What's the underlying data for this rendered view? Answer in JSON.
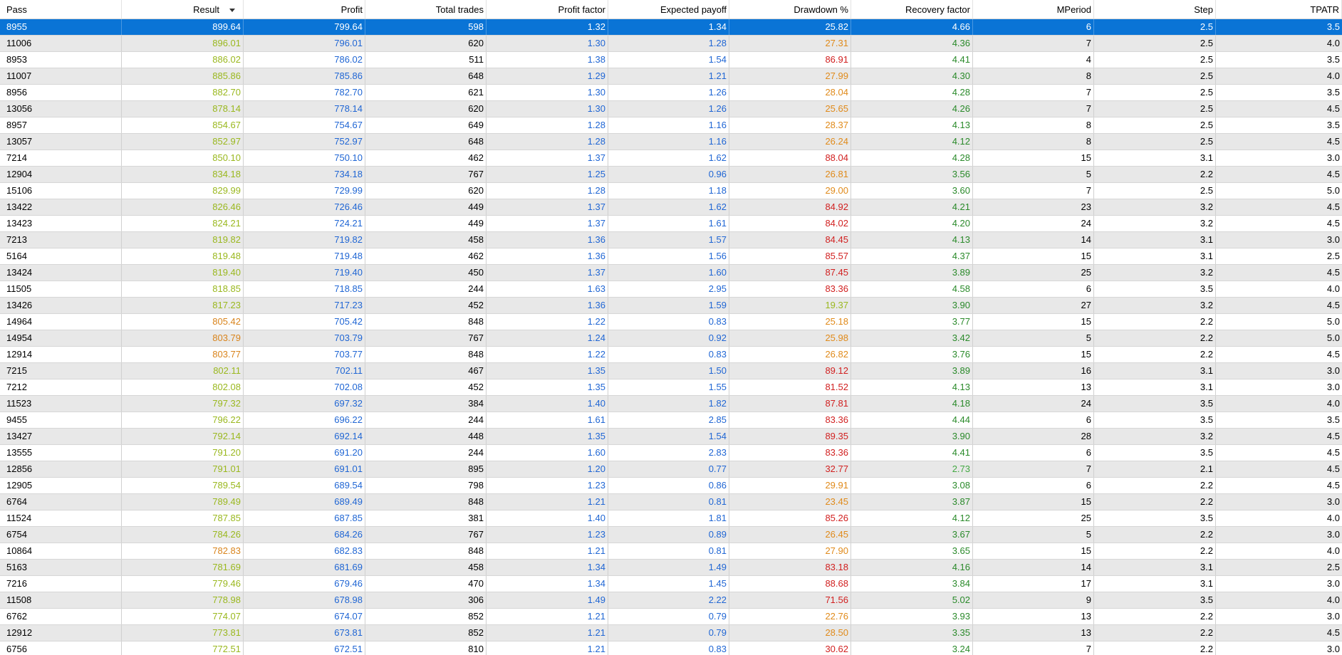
{
  "columns": [
    "Pass",
    "Result",
    "Profit",
    "Total trades",
    "Profit factor",
    "Expected payoff",
    "Drawdown %",
    "Recovery factor",
    "MPeriod",
    "Step",
    "TPATR"
  ],
  "sorted_column": "Result",
  "sort_icon": "chevron-down-icon",
  "colors": {
    "result_yellowgreen": "#9ab81e",
    "result_orange": "#d9841c",
    "blue": "#2066d4",
    "drawdown_red": "#d11f1f",
    "drawdown_orange": "#e08a1a",
    "drawdown_yellowgreen": "#9ab81e",
    "recovery_green": "#2a8a2a",
    "recovery_lightgreen": "#42a842",
    "selected_bg": "#0a74d6"
  },
  "rows": [
    {
      "pass": "8955",
      "result": "899.64",
      "profit": "799.64",
      "trades": "598",
      "pf": "1.32",
      "ep": "1.34",
      "dd": "25.82",
      "rf": "4.66",
      "mperiod": "6",
      "step": "2.5",
      "tpatr": "3.5",
      "rc": "y",
      "dc": "o",
      "fc": "g",
      "selected": true
    },
    {
      "pass": "11006",
      "result": "896.01",
      "profit": "796.01",
      "trades": "620",
      "pf": "1.30",
      "ep": "1.28",
      "dd": "27.31",
      "rf": "4.36",
      "mperiod": "7",
      "step": "2.5",
      "tpatr": "4.0",
      "rc": "y",
      "dc": "o",
      "fc": "g"
    },
    {
      "pass": "8953",
      "result": "886.02",
      "profit": "786.02",
      "trades": "511",
      "pf": "1.38",
      "ep": "1.54",
      "dd": "86.91",
      "rf": "4.41",
      "mperiod": "4",
      "step": "2.5",
      "tpatr": "3.5",
      "rc": "y",
      "dc": "r",
      "fc": "g"
    },
    {
      "pass": "11007",
      "result": "885.86",
      "profit": "785.86",
      "trades": "648",
      "pf": "1.29",
      "ep": "1.21",
      "dd": "27.99",
      "rf": "4.30",
      "mperiod": "8",
      "step": "2.5",
      "tpatr": "4.0",
      "rc": "y",
      "dc": "o",
      "fc": "g"
    },
    {
      "pass": "8956",
      "result": "882.70",
      "profit": "782.70",
      "trades": "621",
      "pf": "1.30",
      "ep": "1.26",
      "dd": "28.04",
      "rf": "4.28",
      "mperiod": "7",
      "step": "2.5",
      "tpatr": "3.5",
      "rc": "y",
      "dc": "o",
      "fc": "g"
    },
    {
      "pass": "13056",
      "result": "878.14",
      "profit": "778.14",
      "trades": "620",
      "pf": "1.30",
      "ep": "1.26",
      "dd": "25.65",
      "rf": "4.26",
      "mperiod": "7",
      "step": "2.5",
      "tpatr": "4.5",
      "rc": "y",
      "dc": "o",
      "fc": "g"
    },
    {
      "pass": "8957",
      "result": "854.67",
      "profit": "754.67",
      "trades": "649",
      "pf": "1.28",
      "ep": "1.16",
      "dd": "28.37",
      "rf": "4.13",
      "mperiod": "8",
      "step": "2.5",
      "tpatr": "3.5",
      "rc": "y",
      "dc": "o",
      "fc": "g"
    },
    {
      "pass": "13057",
      "result": "852.97",
      "profit": "752.97",
      "trades": "648",
      "pf": "1.28",
      "ep": "1.16",
      "dd": "26.24",
      "rf": "4.12",
      "mperiod": "8",
      "step": "2.5",
      "tpatr": "4.5",
      "rc": "y",
      "dc": "o",
      "fc": "g"
    },
    {
      "pass": "7214",
      "result": "850.10",
      "profit": "750.10",
      "trades": "462",
      "pf": "1.37",
      "ep": "1.62",
      "dd": "88.04",
      "rf": "4.28",
      "mperiod": "15",
      "step": "3.1",
      "tpatr": "3.0",
      "rc": "y",
      "dc": "r",
      "fc": "g"
    },
    {
      "pass": "12904",
      "result": "834.18",
      "profit": "734.18",
      "trades": "767",
      "pf": "1.25",
      "ep": "0.96",
      "dd": "26.81",
      "rf": "3.56",
      "mperiod": "5",
      "step": "2.2",
      "tpatr": "4.5",
      "rc": "y",
      "dc": "o",
      "fc": "g"
    },
    {
      "pass": "15106",
      "result": "829.99",
      "profit": "729.99",
      "trades": "620",
      "pf": "1.28",
      "ep": "1.18",
      "dd": "29.00",
      "rf": "3.60",
      "mperiod": "7",
      "step": "2.5",
      "tpatr": "5.0",
      "rc": "y",
      "dc": "o",
      "fc": "g"
    },
    {
      "pass": "13422",
      "result": "826.46",
      "profit": "726.46",
      "trades": "449",
      "pf": "1.37",
      "ep": "1.62",
      "dd": "84.92",
      "rf": "4.21",
      "mperiod": "23",
      "step": "3.2",
      "tpatr": "4.5",
      "rc": "y",
      "dc": "r",
      "fc": "g"
    },
    {
      "pass": "13423",
      "result": "824.21",
      "profit": "724.21",
      "trades": "449",
      "pf": "1.37",
      "ep": "1.61",
      "dd": "84.02",
      "rf": "4.20",
      "mperiod": "24",
      "step": "3.2",
      "tpatr": "4.5",
      "rc": "y",
      "dc": "r",
      "fc": "g"
    },
    {
      "pass": "7213",
      "result": "819.82",
      "profit": "719.82",
      "trades": "458",
      "pf": "1.36",
      "ep": "1.57",
      "dd": "84.45",
      "rf": "4.13",
      "mperiod": "14",
      "step": "3.1",
      "tpatr": "3.0",
      "rc": "y",
      "dc": "r",
      "fc": "g"
    },
    {
      "pass": "5164",
      "result": "819.48",
      "profit": "719.48",
      "trades": "462",
      "pf": "1.36",
      "ep": "1.56",
      "dd": "85.57",
      "rf": "4.37",
      "mperiod": "15",
      "step": "3.1",
      "tpatr": "2.5",
      "rc": "y",
      "dc": "r",
      "fc": "g"
    },
    {
      "pass": "13424",
      "result": "819.40",
      "profit": "719.40",
      "trades": "450",
      "pf": "1.37",
      "ep": "1.60",
      "dd": "87.45",
      "rf": "3.89",
      "mperiod": "25",
      "step": "3.2",
      "tpatr": "4.5",
      "rc": "y",
      "dc": "r",
      "fc": "g"
    },
    {
      "pass": "11505",
      "result": "818.85",
      "profit": "718.85",
      "trades": "244",
      "pf": "1.63",
      "ep": "2.95",
      "dd": "83.36",
      "rf": "4.58",
      "mperiod": "6",
      "step": "3.5",
      "tpatr": "4.0",
      "rc": "y",
      "dc": "r",
      "fc": "g"
    },
    {
      "pass": "13426",
      "result": "817.23",
      "profit": "717.23",
      "trades": "452",
      "pf": "1.36",
      "ep": "1.59",
      "dd": "19.37",
      "rf": "3.90",
      "mperiod": "27",
      "step": "3.2",
      "tpatr": "4.5",
      "rc": "y",
      "dc": "y",
      "fc": "g"
    },
    {
      "pass": "14964",
      "result": "805.42",
      "profit": "705.42",
      "trades": "848",
      "pf": "1.22",
      "ep": "0.83",
      "dd": "25.18",
      "rf": "3.77",
      "mperiod": "15",
      "step": "2.2",
      "tpatr": "5.0",
      "rc": "o",
      "dc": "o",
      "fc": "g"
    },
    {
      "pass": "14954",
      "result": "803.79",
      "profit": "703.79",
      "trades": "767",
      "pf": "1.24",
      "ep": "0.92",
      "dd": "25.98",
      "rf": "3.42",
      "mperiod": "5",
      "step": "2.2",
      "tpatr": "5.0",
      "rc": "o",
      "dc": "o",
      "fc": "g"
    },
    {
      "pass": "12914",
      "result": "803.77",
      "profit": "703.77",
      "trades": "848",
      "pf": "1.22",
      "ep": "0.83",
      "dd": "26.82",
      "rf": "3.76",
      "mperiod": "15",
      "step": "2.2",
      "tpatr": "4.5",
      "rc": "o",
      "dc": "o",
      "fc": "g"
    },
    {
      "pass": "7215",
      "result": "802.11",
      "profit": "702.11",
      "trades": "467",
      "pf": "1.35",
      "ep": "1.50",
      "dd": "89.12",
      "rf": "3.89",
      "mperiod": "16",
      "step": "3.1",
      "tpatr": "3.0",
      "rc": "y",
      "dc": "r",
      "fc": "g"
    },
    {
      "pass": "7212",
      "result": "802.08",
      "profit": "702.08",
      "trades": "452",
      "pf": "1.35",
      "ep": "1.55",
      "dd": "81.52",
      "rf": "4.13",
      "mperiod": "13",
      "step": "3.1",
      "tpatr": "3.0",
      "rc": "y",
      "dc": "r",
      "fc": "g"
    },
    {
      "pass": "11523",
      "result": "797.32",
      "profit": "697.32",
      "trades": "384",
      "pf": "1.40",
      "ep": "1.82",
      "dd": "87.81",
      "rf": "4.18",
      "mperiod": "24",
      "step": "3.5",
      "tpatr": "4.0",
      "rc": "y",
      "dc": "r",
      "fc": "g"
    },
    {
      "pass": "9455",
      "result": "796.22",
      "profit": "696.22",
      "trades": "244",
      "pf": "1.61",
      "ep": "2.85",
      "dd": "83.36",
      "rf": "4.44",
      "mperiod": "6",
      "step": "3.5",
      "tpatr": "3.5",
      "rc": "y",
      "dc": "r",
      "fc": "g"
    },
    {
      "pass": "13427",
      "result": "792.14",
      "profit": "692.14",
      "trades": "448",
      "pf": "1.35",
      "ep": "1.54",
      "dd": "89.35",
      "rf": "3.90",
      "mperiod": "28",
      "step": "3.2",
      "tpatr": "4.5",
      "rc": "y",
      "dc": "r",
      "fc": "g"
    },
    {
      "pass": "13555",
      "result": "791.20",
      "profit": "691.20",
      "trades": "244",
      "pf": "1.60",
      "ep": "2.83",
      "dd": "83.36",
      "rf": "4.41",
      "mperiod": "6",
      "step": "3.5",
      "tpatr": "4.5",
      "rc": "y",
      "dc": "r",
      "fc": "g"
    },
    {
      "pass": "12856",
      "result": "791.01",
      "profit": "691.01",
      "trades": "895",
      "pf": "1.20",
      "ep": "0.77",
      "dd": "32.77",
      "rf": "2.73",
      "mperiod": "7",
      "step": "2.1",
      "tpatr": "4.5",
      "rc": "y",
      "dc": "r",
      "fc": "l"
    },
    {
      "pass": "12905",
      "result": "789.54",
      "profit": "689.54",
      "trades": "798",
      "pf": "1.23",
      "ep": "0.86",
      "dd": "29.91",
      "rf": "3.08",
      "mperiod": "6",
      "step": "2.2",
      "tpatr": "4.5",
      "rc": "y",
      "dc": "o",
      "fc": "g"
    },
    {
      "pass": "6764",
      "result": "789.49",
      "profit": "689.49",
      "trades": "848",
      "pf": "1.21",
      "ep": "0.81",
      "dd": "23.45",
      "rf": "3.87",
      "mperiod": "15",
      "step": "2.2",
      "tpatr": "3.0",
      "rc": "y",
      "dc": "o",
      "fc": "g"
    },
    {
      "pass": "11524",
      "result": "787.85",
      "profit": "687.85",
      "trades": "381",
      "pf": "1.40",
      "ep": "1.81",
      "dd": "85.26",
      "rf": "4.12",
      "mperiod": "25",
      "step": "3.5",
      "tpatr": "4.0",
      "rc": "y",
      "dc": "r",
      "fc": "g"
    },
    {
      "pass": "6754",
      "result": "784.26",
      "profit": "684.26",
      "trades": "767",
      "pf": "1.23",
      "ep": "0.89",
      "dd": "26.45",
      "rf": "3.67",
      "mperiod": "5",
      "step": "2.2",
      "tpatr": "3.0",
      "rc": "y",
      "dc": "o",
      "fc": "g"
    },
    {
      "pass": "10864",
      "result": "782.83",
      "profit": "682.83",
      "trades": "848",
      "pf": "1.21",
      "ep": "0.81",
      "dd": "27.90",
      "rf": "3.65",
      "mperiod": "15",
      "step": "2.2",
      "tpatr": "4.0",
      "rc": "o",
      "dc": "o",
      "fc": "g"
    },
    {
      "pass": "5163",
      "result": "781.69",
      "profit": "681.69",
      "trades": "458",
      "pf": "1.34",
      "ep": "1.49",
      "dd": "83.18",
      "rf": "4.16",
      "mperiod": "14",
      "step": "3.1",
      "tpatr": "2.5",
      "rc": "y",
      "dc": "r",
      "fc": "g"
    },
    {
      "pass": "7216",
      "result": "779.46",
      "profit": "679.46",
      "trades": "470",
      "pf": "1.34",
      "ep": "1.45",
      "dd": "88.68",
      "rf": "3.84",
      "mperiod": "17",
      "step": "3.1",
      "tpatr": "3.0",
      "rc": "y",
      "dc": "r",
      "fc": "g"
    },
    {
      "pass": "11508",
      "result": "778.98",
      "profit": "678.98",
      "trades": "306",
      "pf": "1.49",
      "ep": "2.22",
      "dd": "71.56",
      "rf": "5.02",
      "mperiod": "9",
      "step": "3.5",
      "tpatr": "4.0",
      "rc": "y",
      "dc": "r",
      "fc": "g"
    },
    {
      "pass": "6762",
      "result": "774.07",
      "profit": "674.07",
      "trades": "852",
      "pf": "1.21",
      "ep": "0.79",
      "dd": "22.76",
      "rf": "3.93",
      "mperiod": "13",
      "step": "2.2",
      "tpatr": "3.0",
      "rc": "y",
      "dc": "o",
      "fc": "g"
    },
    {
      "pass": "12912",
      "result": "773.81",
      "profit": "673.81",
      "trades": "852",
      "pf": "1.21",
      "ep": "0.79",
      "dd": "28.50",
      "rf": "3.35",
      "mperiod": "13",
      "step": "2.2",
      "tpatr": "4.5",
      "rc": "y",
      "dc": "o",
      "fc": "g"
    },
    {
      "pass": "6756",
      "result": "772.51",
      "profit": "672.51",
      "trades": "810",
      "pf": "1.21",
      "ep": "0.83",
      "dd": "30.62",
      "rf": "3.24",
      "mperiod": "7",
      "step": "2.2",
      "tpatr": "3.0",
      "rc": "y",
      "dc": "r",
      "fc": "g"
    }
  ]
}
